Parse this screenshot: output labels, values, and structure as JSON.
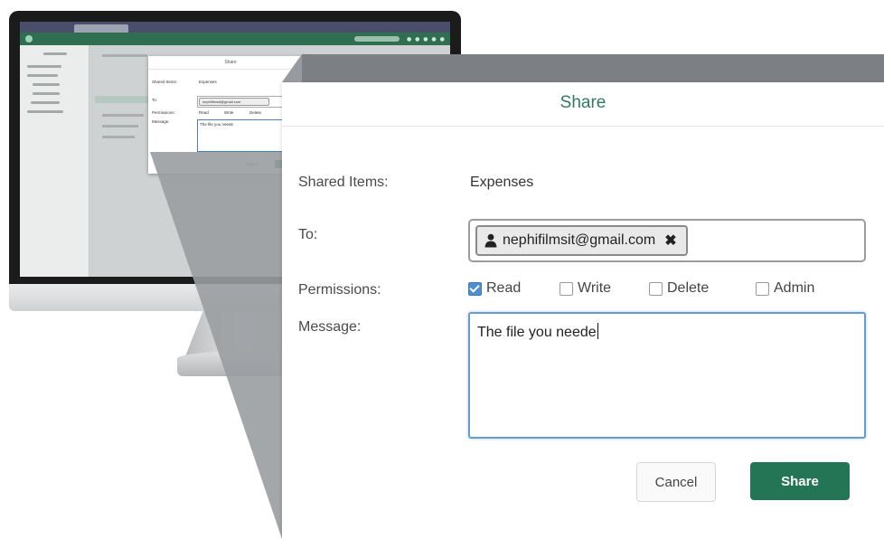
{
  "dialog": {
    "title": "Share",
    "shared_items_label": "Shared Items:",
    "shared_items_value": "Expenses",
    "to_label": "To:",
    "recipient_email": "nephifilmsit@gmail.com",
    "remove_recipient_glyph": "✖",
    "permissions_label": "Permissions:",
    "permissions": [
      {
        "label": "Read",
        "checked": true
      },
      {
        "label": "Write",
        "checked": false
      },
      {
        "label": "Delete",
        "checked": false
      },
      {
        "label": "Admin",
        "checked": false
      }
    ],
    "message_label": "Message:",
    "message_value": "The file you neede",
    "cancel_label": "Cancel",
    "share_label": "Share"
  },
  "monitor_dialog": {
    "title": "Share",
    "shared_items_label": "Shared Items:",
    "shared_items_value": "Expenses",
    "to_label": "To:",
    "recipient_email": "nephifilmsit@gmail.com",
    "permissions_label": "Permissions:",
    "permissions": [
      "Read",
      "Write",
      "Delete"
    ],
    "message_label": "Message:",
    "message_value": "The file you neede",
    "cancel_label": "Cancel"
  },
  "icons": {
    "recipient": "person-icon",
    "remove": "close-icon",
    "checkbox": "checkbox-icon"
  },
  "colors": {
    "accent": "#237556",
    "title": "#2f7b62",
    "checkbox_checked": "#4f8fcf",
    "focus_border": "#6a9bd0"
  }
}
